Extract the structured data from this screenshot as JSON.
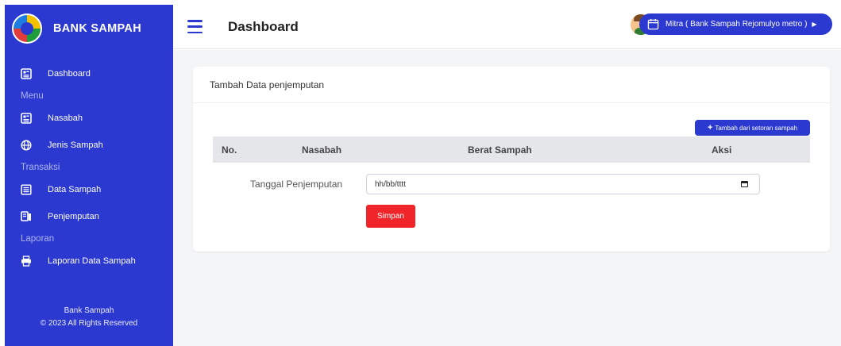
{
  "sidebar": {
    "brand": "BANK SAMPAH",
    "items": [
      {
        "label": "Dashboard",
        "icon": "dashboard-icon"
      },
      {
        "heading": "Menu"
      },
      {
        "label": "Nasabah",
        "icon": "nasabah-icon"
      },
      {
        "label": "Jenis Sampah",
        "icon": "globe-icon"
      },
      {
        "heading": "Transaksi"
      },
      {
        "label": "Data Sampah",
        "icon": "list-icon"
      },
      {
        "label": "Penjemputan",
        "icon": "truck-icon"
      },
      {
        "heading": "Laporan"
      },
      {
        "label": "Laporan Data Sampah",
        "icon": "print-icon"
      }
    ],
    "footer_line1": "Bank Sampah",
    "footer_line2": "© 2023 All Rights Reserved"
  },
  "header": {
    "title": "Dashboard",
    "mitra_label": "Mitra ( Bank Sampah Rejomulyo metro )"
  },
  "card": {
    "title": "Tambah Data penjemputan",
    "add_button": "Tambah dari setoran sampah",
    "columns": [
      "No.",
      "Nasabah",
      "Berat Sampah",
      "Aksi"
    ],
    "date_label": "Tanggal Penjemputan",
    "date_placeholder": "hh/bb/tttt",
    "save_button": "Simpan"
  },
  "colors": {
    "primary": "#2b39d0",
    "danger": "#f0252a",
    "background": "#f4f5f7"
  }
}
